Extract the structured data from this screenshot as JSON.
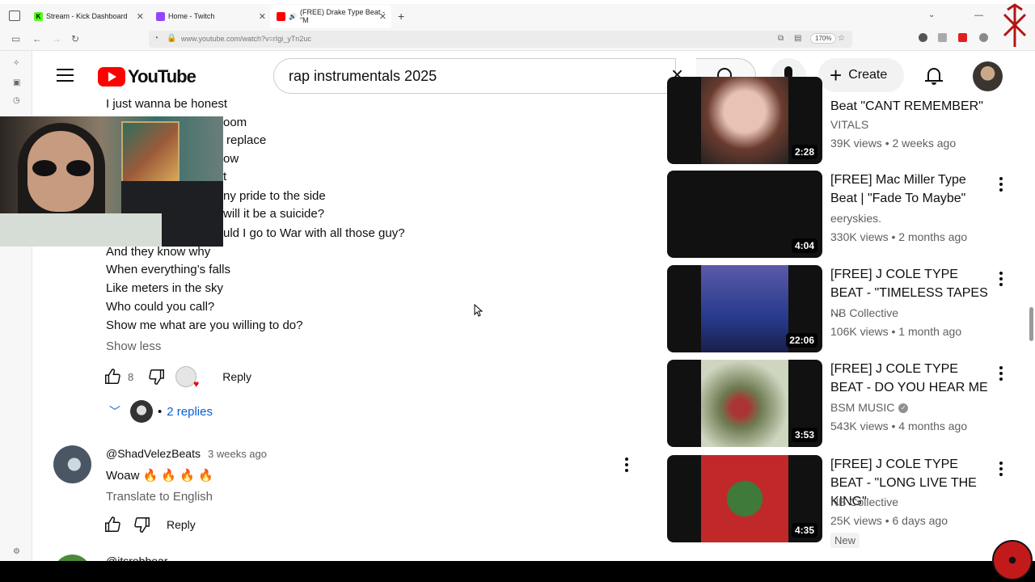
{
  "browser": {
    "tabs": [
      {
        "title": "Stream - Kick Dashboard",
        "fav_color": "#53fc18",
        "fav_letter": "K"
      },
      {
        "title": "Home - Twitch",
        "fav_color": "#9146ff",
        "fav_letter": ""
      },
      {
        "title": "(FREE) Drake Type Beat - \"M",
        "fav_color": "#ff0000",
        "fav_letter": "",
        "active": true
      }
    ],
    "url": "www.youtube.com/watch?v=rIgi_yTn2uc",
    "zoom": "170%"
  },
  "youtube": {
    "logo_text": "YouTube",
    "search_query": "rap instrumentals 2025",
    "create_label": "Create"
  },
  "comment1": {
    "lines": [
      "I just wanna be honest",
      "room",
      "replace",
      "ow",
      "t",
      "ny pride to the side",
      "will it be a suicide?",
      "uld I go to War with all those guy?",
      "And they know why",
      "When everything’s falls",
      "Like meters in the sky",
      "Who could you call?",
      "Show me what are you willing to do?"
    ],
    "show_less": "Show less",
    "likes": "8",
    "reply": "Reply",
    "replies": "2 replies"
  },
  "comment2": {
    "author": "@ShadVelezBeats",
    "time": "3 weeks ago",
    "text": "Woaw 🔥 🔥 🔥 🔥",
    "translate": "Translate to English",
    "reply": "Reply"
  },
  "next_comment_author": "@itsrobbear...",
  "recommendations": [
    {
      "title": "Beat \"CANT REMEMBER\"",
      "channel": "VITALS",
      "views": "39K views",
      "age": "2 weeks ago",
      "duration": "2:28",
      "art": "#c9867a"
    },
    {
      "title": "[FREE] Mac Miller Type Beat | \"Fade To Maybe\"",
      "channel": "eeryskies.",
      "views": "330K views",
      "age": "2 months ago",
      "duration": "4:04",
      "art": "#3d6b44"
    },
    {
      "title": "[FREE] J COLE TYPE BEAT - \"TIMELESS TAPES ...",
      "channel": "NB Collective",
      "views": "106K views",
      "age": "1 month ago",
      "duration": "22:06",
      "art": "#2c3f8a"
    },
    {
      "title": "[FREE] J COLE TYPE BEAT - DO YOU HEAR ME",
      "channel": "BSM MUSIC",
      "views": "543K views",
      "age": "4 months ago",
      "duration": "3:53",
      "art": "#5f6e4a",
      "verified": true
    },
    {
      "title": "[FREE] J COLE TYPE BEAT - \"LONG LIVE THE KING\"",
      "channel": "NB Collective",
      "views": "25K views",
      "age": "6 days ago",
      "duration": "4:35",
      "art": "#c0282a",
      "badge": "New"
    }
  ],
  "colors": {
    "yt_red": "#ff0000",
    "link_blue": "#065fd4",
    "secondary_text": "#606060"
  }
}
